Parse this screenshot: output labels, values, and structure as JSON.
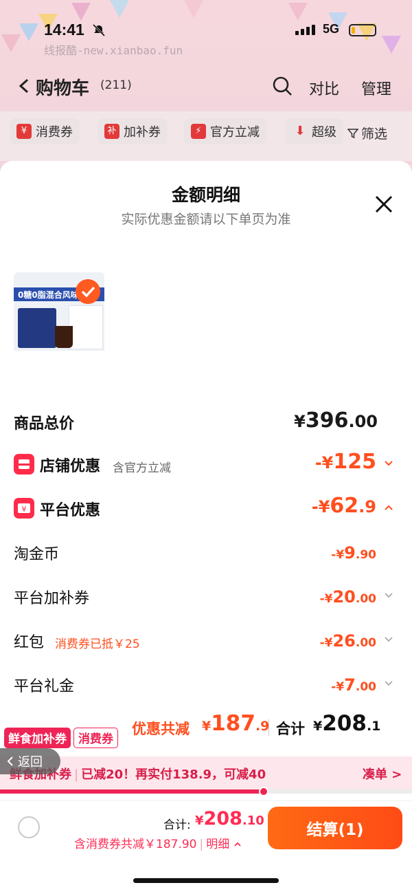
{
  "status_bar": {
    "time": "14:41",
    "network": "5G"
  },
  "watermark": "线报酷-new.xianbao.fun",
  "nav": {
    "title": "购物车",
    "count": "(211)",
    "compare_label": "对比",
    "manage_label": "管理"
  },
  "filters": {
    "chips": [
      {
        "icon_char": "¥",
        "label": "消费券"
      },
      {
        "icon_char": "补",
        "label": "加补券"
      },
      {
        "icon_char": "⚡",
        "label": "官方立减"
      },
      {
        "icon_char": "⬇",
        "label": "超级"
      }
    ],
    "filter_label": "筛选"
  },
  "sheet": {
    "title": "金额明细",
    "subtitle": "实际优惠金额请以下单页为准",
    "product_image_text": "0糖0脂混合风味",
    "rows": {
      "total_price": {
        "label": "商品总价",
        "currency": "¥",
        "int": "396",
        "dec": ".00"
      },
      "shop_discount": {
        "label": "店铺优惠",
        "note": "含官方立减",
        "prefix": "-¥",
        "int": "125",
        "dec": ""
      },
      "platform_discount": {
        "label": "平台优惠",
        "prefix": "-¥",
        "int": "62",
        "dec": ".9"
      },
      "taojinbi": {
        "label": "淘金币",
        "prefix": "-¥",
        "int": "9",
        "dec": ".90"
      },
      "platform_subsidy": {
        "label": "平台加补券",
        "prefix": "-¥",
        "int": "20",
        "dec": ".00"
      },
      "red_packet": {
        "label": "红包",
        "note": "消费券已抵￥25",
        "prefix": "-¥",
        "int": "26",
        "dec": ".00"
      },
      "platform_gift": {
        "label": "平台礼金",
        "prefix": "-¥",
        "int": "7",
        "dec": ".00"
      }
    },
    "summary": {
      "saved_label": "优惠共减",
      "saved_prefix": "¥",
      "saved_int": "187",
      "saved_dec": ".9",
      "total_label": "合计",
      "total_prefix": "¥",
      "total_int": "208",
      "total_dec": ".1"
    }
  },
  "tags": {
    "fresh_subsidy": "鲜食加补券",
    "consumer_coupon": "消费券"
  },
  "back_label": "返回",
  "promo": {
    "name": "鲜食加补券",
    "message": "已减20！再实付138.9，可减40",
    "link": "凑单 >",
    "progress": 0.64
  },
  "checkout": {
    "total_label": "合计:",
    "total_prefix": "¥",
    "total_int": "208",
    "total_dec": ".10",
    "detail_text": "含消费券共减￥187.90",
    "detail_link": "明细",
    "pay_button": "结算(1)"
  },
  "colors": {
    "accent_orange": "#ff4f1f",
    "accent_red": "#ee2456",
    "pay_button": "#ff5a16"
  }
}
